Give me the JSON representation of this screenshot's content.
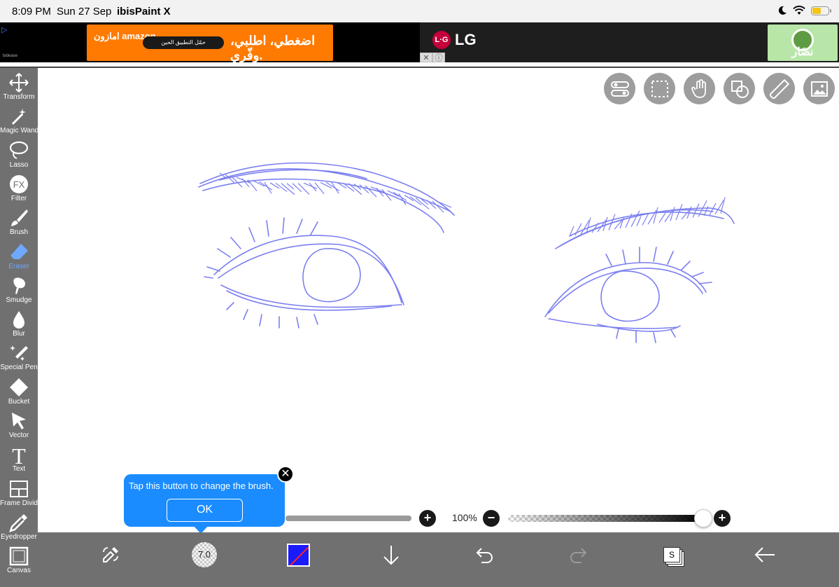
{
  "status_bar": {
    "time": "8:09 PM",
    "date": "Sun 27 Sep",
    "app_name": "ibisPaint X",
    "battery_level": 0.55
  },
  "ads": {
    "amazon_logo": "امازون amazon",
    "amazon_button": "حمّل التطبيق الحين",
    "amazon_tagline": "اضغطي، اطلبي، وفّري.",
    "lg_brand": "LG",
    "salad_text": "نصّار"
  },
  "tools": [
    {
      "label": "Transform",
      "icon": "move-arrows-icon"
    },
    {
      "label": "Magic Wand",
      "icon": "magic-wand-icon"
    },
    {
      "label": "Lasso",
      "icon": "lasso-icon"
    },
    {
      "label": "Filter",
      "icon": "fx-icon"
    },
    {
      "label": "Brush",
      "icon": "brush-icon"
    },
    {
      "label": "Eraser",
      "icon": "eraser-icon",
      "active": true
    },
    {
      "label": "Smudge",
      "icon": "smudge-icon"
    },
    {
      "label": "Blur",
      "icon": "blur-drop-icon"
    },
    {
      "label": "Special Pen",
      "icon": "special-pen-icon"
    },
    {
      "label": "Bucket",
      "icon": "bucket-icon"
    },
    {
      "label": "Vector",
      "icon": "vector-arrow-icon"
    },
    {
      "label": "Text",
      "icon": "text-icon"
    },
    {
      "label": "Frame Divider",
      "icon": "frame-divider-icon"
    },
    {
      "label": "Eyedropper",
      "icon": "eyedropper-icon"
    },
    {
      "label": "Canvas",
      "icon": "canvas-icon"
    }
  ],
  "quick_tools": [
    "toggle-icon",
    "selection-icon",
    "hand-icon",
    "shapes-icon",
    "ruler-icon",
    "image-icon"
  ],
  "tooltip": {
    "text": "Tap this button to change the brush.",
    "ok_label": "OK"
  },
  "brush": {
    "size": "7.0"
  },
  "opacity": {
    "label": "100%",
    "value": 1.0
  },
  "colors": {
    "accent": "#1a8cff",
    "stroke": "#7b7ff0",
    "current_color": "#1a1aff",
    "toolbar": "#707070"
  }
}
